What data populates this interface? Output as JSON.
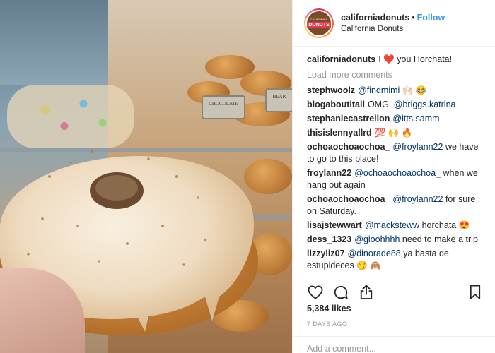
{
  "header": {
    "username": "californiadonuts",
    "separator": "•",
    "follow_label": "Follow",
    "location": "California Donuts",
    "avatar_text_top": "CALIFORNIA",
    "avatar_text_main": "DONUTS"
  },
  "photo": {
    "sign1": "CHOCOLATE",
    "sign2": "BEAR"
  },
  "caption": {
    "author": "californiadonuts",
    "pre_heart": "I",
    "heart": "❤️",
    "post_heart": "you Horchata!"
  },
  "load_more_label": "Load more comments",
  "comments": [
    {
      "author": "stephwoolz",
      "mention": "@findmimi",
      "text": "🙌🏻 😂"
    },
    {
      "author": "blogaboutitall",
      "pre": "OMG!",
      "mention": "@briggs.katrina",
      "text": ""
    },
    {
      "author": "stephaniecastrellon",
      "mention": "@itts.samm",
      "text": ""
    },
    {
      "author": "thisislennyallrd",
      "mention": "",
      "text": "💯 🙌 🔥"
    },
    {
      "author": "ochoaochoaochoa_",
      "mention": "@froylann22",
      "text": "we have to go to this place!"
    },
    {
      "author": "froylann22",
      "mention": "@ochoaochoaochoa_",
      "text": "when we hang out again"
    },
    {
      "author": "ochoaochoaochoa_",
      "mention": "@froylann22",
      "text": "for sure , on Saturday."
    },
    {
      "author": "lisajstewwart",
      "mention": "@mackstеww",
      "text": "horchata 😍"
    },
    {
      "author": "dess_1323",
      "mention": "@gioohhhh",
      "text": "need to make a trip"
    },
    {
      "author": "lizzyliz07",
      "mention": "@dinorade88",
      "text": "ya basta de estupideces 😏 🙈"
    }
  ],
  "actions": {
    "like_icon": "heart-icon",
    "comment_icon": "comment-icon",
    "share_icon": "share-icon",
    "save_icon": "bookmark-icon"
  },
  "likes": "5,384 likes",
  "date": "7 DAYS AGO",
  "add_comment": {
    "placeholder": "Add a comment..."
  }
}
